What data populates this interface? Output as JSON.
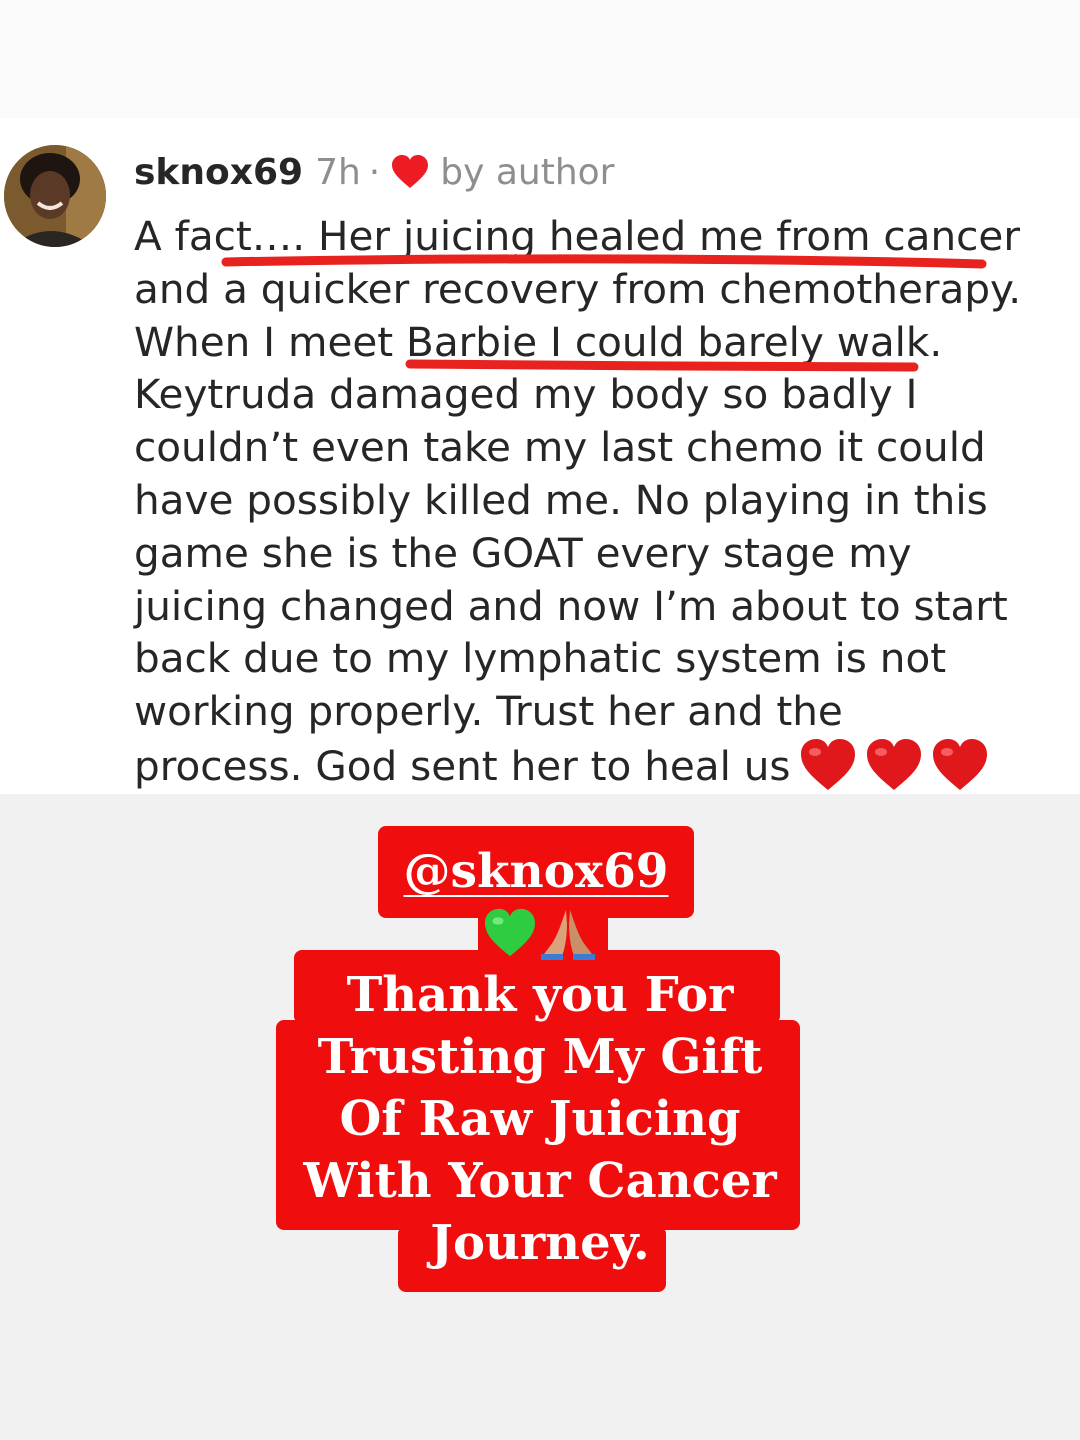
{
  "comment": {
    "username": "sknox69",
    "time": "7h",
    "separator": "·",
    "author_tag": "by author",
    "lines": [
      "A fact…. Her juicing healed me from cancer",
      "and a quicker recovery from chemotherapy.",
      "When I meet Barbie I could barely walk.",
      "Keytruda damaged my body so badly I",
      "couldn’t even take my last chemo it could",
      "have possibly killed me. No playing in this",
      "game she is the GOAT every stage my",
      "juicing changed and now I’m about to start",
      "back due to my lymphatic system is not",
      "working properly. Trust her and the",
      "process. God sent her to heal us"
    ],
    "trailing_emoji": "red-heart-icon x3",
    "highlight_color": "#e8231f"
  },
  "story": {
    "handle": "@sknox69",
    "emojis": [
      "green-heart-icon",
      "folded-hands-icon"
    ],
    "thanks_lines": [
      "Thank you For",
      "Trusting My Gift",
      "Of Raw Juicing",
      "With Your Cancer",
      "Journey."
    ],
    "box_color": "#f00d0d",
    "text_color": "#ffffff"
  }
}
